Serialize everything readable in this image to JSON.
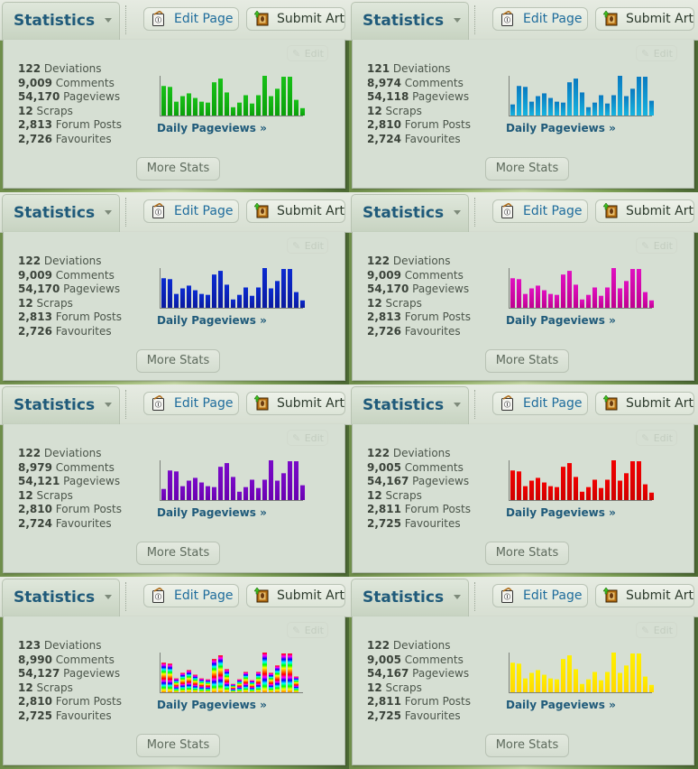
{
  "common": {
    "tab_title": "Statistics",
    "edit_page": "Edit Page",
    "submit_art": "Submit Art",
    "ghost_edit": "Edit",
    "daily_link": "Daily Pageviews »",
    "more_stats": "More Stats",
    "labels": {
      "deviations": "Deviations",
      "comments": "Comments",
      "pageviews": "Pageviews",
      "scraps": "Scraps",
      "forum_posts": "Forum Posts",
      "favourites": "Favourites"
    }
  },
  "icons": {
    "tab_caret": "chevron-down-icon",
    "edit_page": "page-info-icon",
    "submit_art": "framed-art-upload-icon",
    "ghost_edit": "pencil-icon"
  },
  "panels": [
    {
      "id": "green",
      "color_top": "#18c018",
      "color_bottom": "#0aa00a",
      "stats": {
        "deviations": "122",
        "comments": "9,009",
        "pageviews": "54,170",
        "scraps": "12",
        "forum_posts": "2,813",
        "favourites": "2,726"
      },
      "pattern": "A"
    },
    {
      "id": "blue",
      "color_top": "#0a7ac0",
      "color_bottom": "#16b4e0",
      "stats": {
        "deviations": "121",
        "comments": "8,974",
        "pageviews": "54,118",
        "scraps": "12",
        "forum_posts": "2,810",
        "favourites": "2,724"
      },
      "pattern": "B"
    },
    {
      "id": "navy",
      "color_top": "#0a2ad0",
      "color_bottom": "#0a1aa0",
      "stats": {
        "deviations": "122",
        "comments": "9,009",
        "pageviews": "54,170",
        "scraps": "12",
        "forum_posts": "2,813",
        "favourites": "2,726"
      },
      "pattern": "A"
    },
    {
      "id": "magenta",
      "color_top": "#e010c0",
      "color_bottom": "#c00090",
      "stats": {
        "deviations": "122",
        "comments": "9,009",
        "pageviews": "54,170",
        "scraps": "12",
        "forum_posts": "2,813",
        "favourites": "2,726"
      },
      "pattern": "A"
    },
    {
      "id": "purple",
      "color_top": "#7a0ac8",
      "color_bottom": "#6a00b0",
      "stats": {
        "deviations": "122",
        "comments": "8,979",
        "pageviews": "54,121",
        "scraps": "12",
        "forum_posts": "2,810",
        "favourites": "2,724"
      },
      "pattern": "B"
    },
    {
      "id": "red",
      "color_top": "#f00000",
      "color_bottom": "#d00000",
      "stats": {
        "deviations": "122",
        "comments": "9,005",
        "pageviews": "54,167",
        "scraps": "12",
        "forum_posts": "2,811",
        "favourites": "2,725"
      },
      "pattern": "A"
    },
    {
      "id": "rainbow",
      "color_top": "rainbow",
      "color_bottom": "rainbow",
      "stats": {
        "deviations": "123",
        "comments": "8,990",
        "pageviews": "54,127",
        "scraps": "12",
        "forum_posts": "2,810",
        "favourites": "2,725"
      },
      "pattern": "C"
    },
    {
      "id": "yellow",
      "color_top": "#fff000",
      "color_bottom": "#ffd800",
      "stats": {
        "deviations": "122",
        "comments": "9,005",
        "pageviews": "54,167",
        "scraps": "12",
        "forum_posts": "2,811",
        "favourites": "2,725"
      },
      "pattern": "A"
    }
  ],
  "chart_data": [
    {
      "type": "bar",
      "title": "Daily Pageviews",
      "series_name": "A",
      "values": [
        96,
        93,
        45,
        63,
        72,
        57,
        45,
        42,
        108,
        120,
        75,
        27,
        42,
        66,
        39,
        66,
        129,
        63,
        87,
        126,
        126,
        51,
        24
      ],
      "ylim": [
        0,
        129
      ]
    },
    {
      "type": "bar",
      "title": "Daily Pageviews",
      "series_name": "B",
      "values": [
        36,
        96,
        93,
        45,
        63,
        72,
        57,
        45,
        42,
        108,
        120,
        75,
        27,
        42,
        66,
        39,
        66,
        129,
        63,
        87,
        126,
        126,
        48
      ],
      "ylim": [
        0,
        129
      ]
    },
    {
      "type": "bar",
      "title": "Daily Pageviews",
      "series_name": "C",
      "values": [
        96,
        93,
        45,
        63,
        72,
        57,
        45,
        42,
        108,
        120,
        75,
        27,
        42,
        66,
        39,
        66,
        129,
        63,
        87,
        126,
        126,
        51
      ],
      "ylim": [
        0,
        129
      ]
    }
  ]
}
